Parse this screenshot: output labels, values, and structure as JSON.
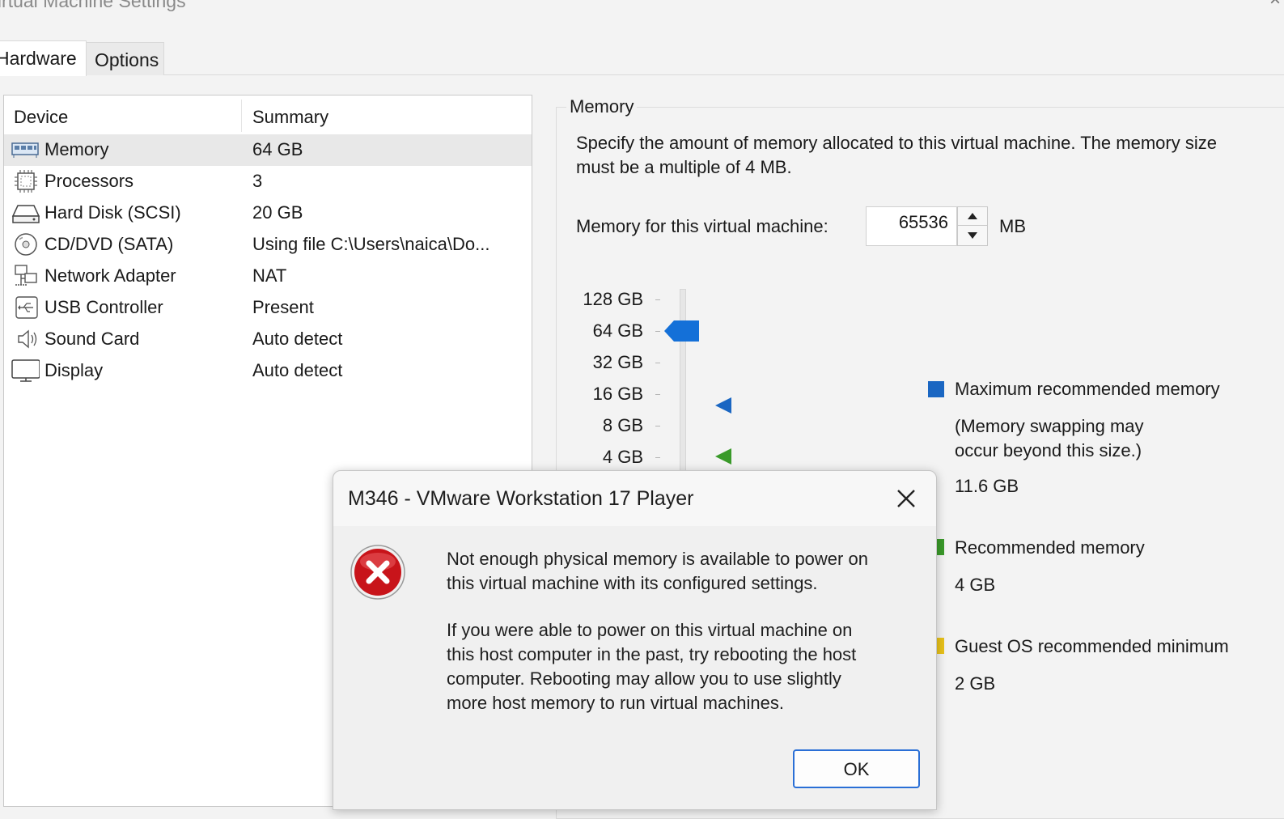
{
  "window": {
    "title": "Virtual Machine Settings",
    "close_glyph": "×"
  },
  "tabs": [
    {
      "label": "Hardware"
    },
    {
      "label": "Options"
    }
  ],
  "device_list": {
    "col_device": "Device",
    "col_summary": "Summary",
    "rows": [
      {
        "device": "Memory",
        "summary": "64 GB",
        "icon": "memory-icon"
      },
      {
        "device": "Processors",
        "summary": "3",
        "icon": "processor-icon"
      },
      {
        "device": "Hard Disk (SCSI)",
        "summary": "20 GB",
        "icon": "hard-disk-icon"
      },
      {
        "device": "CD/DVD (SATA)",
        "summary": "Using file C:\\Users\\naica\\Do...",
        "icon": "cd-dvd-icon"
      },
      {
        "device": "Network Adapter",
        "summary": "NAT",
        "icon": "network-icon"
      },
      {
        "device": "USB Controller",
        "summary": "Present",
        "icon": "usb-icon"
      },
      {
        "device": "Sound Card",
        "summary": "Auto detect",
        "icon": "speaker-icon"
      },
      {
        "device": "Display",
        "summary": "Auto detect",
        "icon": "monitor-icon"
      }
    ]
  },
  "memory": {
    "group_label": "Memory",
    "description": "Specify the amount of memory allocated to this virtual machine. The memory size must be a multiple of 4 MB.",
    "field_label": "Memory for this virtual machine:",
    "value": "65536",
    "unit": "MB",
    "scale_labels": [
      "128 GB",
      "64 GB",
      "32 GB",
      "16 GB",
      "8 GB",
      "4 GB"
    ],
    "legend": {
      "max_title": "Maximum recommended memory",
      "max_note_1": "(Memory swapping may",
      "max_note_2": "occur beyond this size.)",
      "max_value": "11.6 GB",
      "rec_title": "Recommended memory",
      "rec_value": "4 GB",
      "min_title": "Guest OS recommended minimum",
      "min_value": "2 GB"
    },
    "colors": {
      "max": "#1a66c2",
      "rec": "#3a9a2a",
      "min": "#e8c21a",
      "thumb": "#1470d8"
    }
  },
  "dialog": {
    "title": "M346 - VMware Workstation 17 Player",
    "message_1_line_1": "Not enough physical memory is available to power on",
    "message_1_line_2": "this virtual machine with its configured settings.",
    "message_2_line_1": "If you were able to power on this virtual machine on",
    "message_2_line_2": "this host computer in the past, try rebooting the host",
    "message_2_line_3": "computer. Rebooting may allow you to use slightly",
    "message_2_line_4": "more host memory to run virtual machines.",
    "ok_label": "OK",
    "icon": "error-icon"
  }
}
